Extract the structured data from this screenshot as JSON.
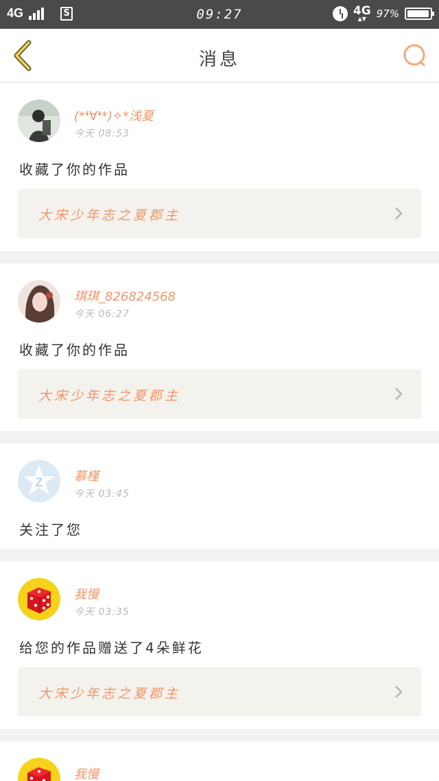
{
  "status_bar": {
    "network_left": "4G",
    "sim_label": "S",
    "time": "09:27",
    "network_right": "4G",
    "battery": "97%",
    "battery_level": 0.97
  },
  "header": {
    "title": "消息",
    "back_icon": "back-chevron-icon",
    "search_icon": "search-icon"
  },
  "messages": [
    {
      "username": "(*❛∀❛*)✧*浅夏",
      "time": "今天 08:53",
      "action": "收藏了你的作品",
      "work_title": "大宋少年志之夏郡主",
      "avatar": "photo-avatar"
    },
    {
      "username": "琪琪_826824568",
      "time": "今天 06:27",
      "action": "收藏了你的作品",
      "work_title": "大宋少年志之夏郡主",
      "avatar": "photo-avatar"
    },
    {
      "username": "慕槿",
      "time": "今天 03:45",
      "action": "关注了您",
      "avatar": "default-avatar"
    },
    {
      "username": "我慢",
      "time": "今天 03:35",
      "action": "给您的作品赠送了4朵鲜花",
      "work_title": "大宋少年志之夏郡主",
      "avatar": "dice-avatar"
    },
    {
      "username": "我慢",
      "avatar": "dice-avatar"
    }
  ],
  "colors": {
    "accent": "#f0956a",
    "status_bar": "#4a4a4a",
    "background": "#f2f2f2",
    "link_box": "#f3f2ed"
  }
}
